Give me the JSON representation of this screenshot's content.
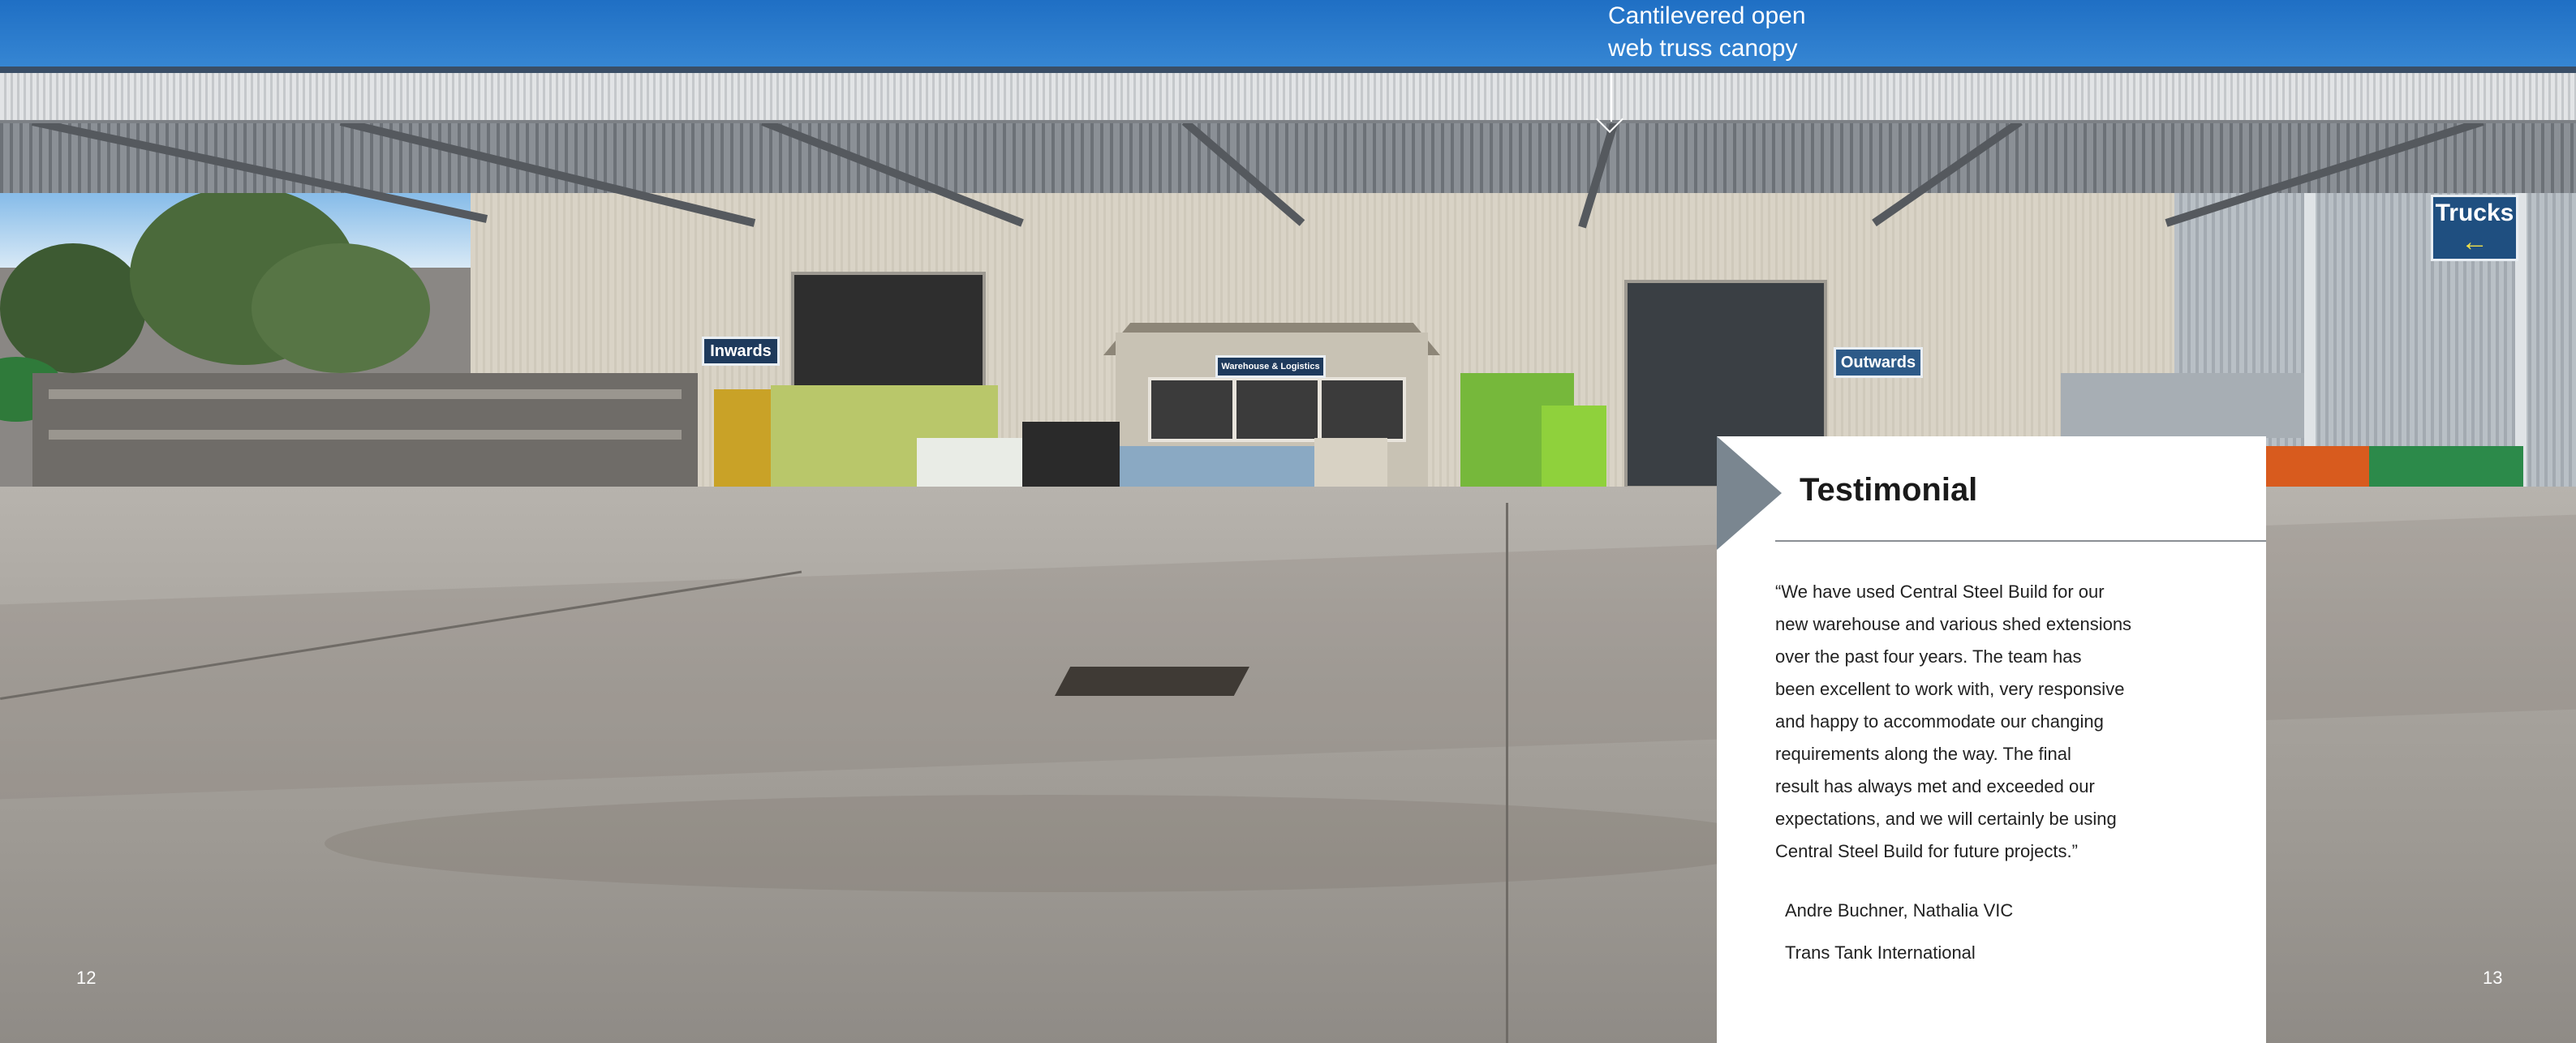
{
  "caption": {
    "text": "Cantilevered open\nweb truss canopy",
    "arrow_icon": "down-arrow-icon"
  },
  "photo_signs": {
    "inwards": "Inwards",
    "warehouse": "Warehouse & Logistics",
    "outwards": "Outwards",
    "trucks": "Trucks"
  },
  "testimonial": {
    "heading": "Testimonial",
    "quote": "“We have used Central Steel Build for our\n  new warehouse and various shed extensions\n  over the past four years. The team has\n  been excellent to work with, very responsive\n  and happy to accommodate our changing\n  requirements along the way. The final\n  result has always met and exceeded our\n  expectations, and we will certainly be using\n  Central Steel Build for future projects.”",
    "author": "Andre Buchner, Nathalia VIC",
    "company": "Trans Tank International",
    "accent_color": "#7a8690"
  },
  "page_numbers": {
    "left": "12",
    "right": "13"
  }
}
